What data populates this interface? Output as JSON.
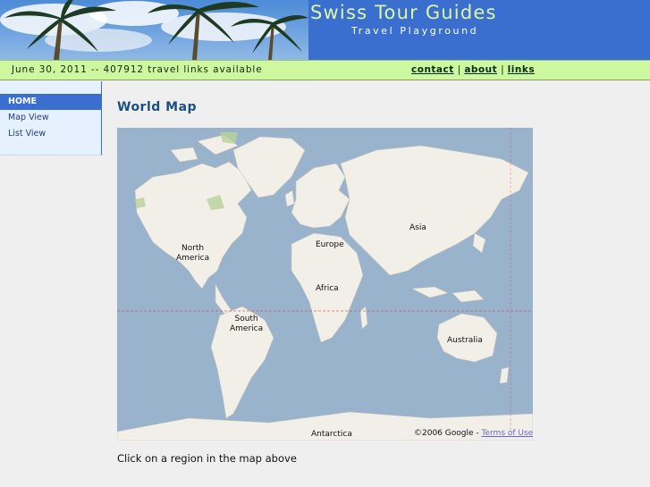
{
  "header": {
    "title": "Swiss Tour Guides",
    "subtitle": "Travel Playground"
  },
  "infobar": {
    "status_text": "June 30, 2011 -- 407912 travel links available",
    "links": [
      {
        "label": "contact"
      },
      {
        "label": "about"
      },
      {
        "label": "links"
      }
    ]
  },
  "sidebar": {
    "items": [
      {
        "label": "HOME",
        "active": true
      },
      {
        "label": "Map View"
      },
      {
        "label": "List View"
      }
    ]
  },
  "main": {
    "title": "World Map",
    "map": {
      "regions": [
        {
          "label": "North America"
        },
        {
          "label": "Europe"
        },
        {
          "label": "Asia"
        },
        {
          "label": "Africa"
        },
        {
          "label": "South America"
        },
        {
          "label": "Australia"
        },
        {
          "label": "Antarctica"
        }
      ],
      "copyright": "©2006 Google -",
      "terms_label": "Terms of Use"
    },
    "caption": "Click on a region in the map above"
  },
  "colors": {
    "header_bg": "#3a6fcf",
    "title_color": "#dcf7a3",
    "infobar_bg": "#cdf8a0",
    "sidebar_bg": "#e6f1ff",
    "ocean": "#99b3cc",
    "land": "#f2efe9"
  }
}
